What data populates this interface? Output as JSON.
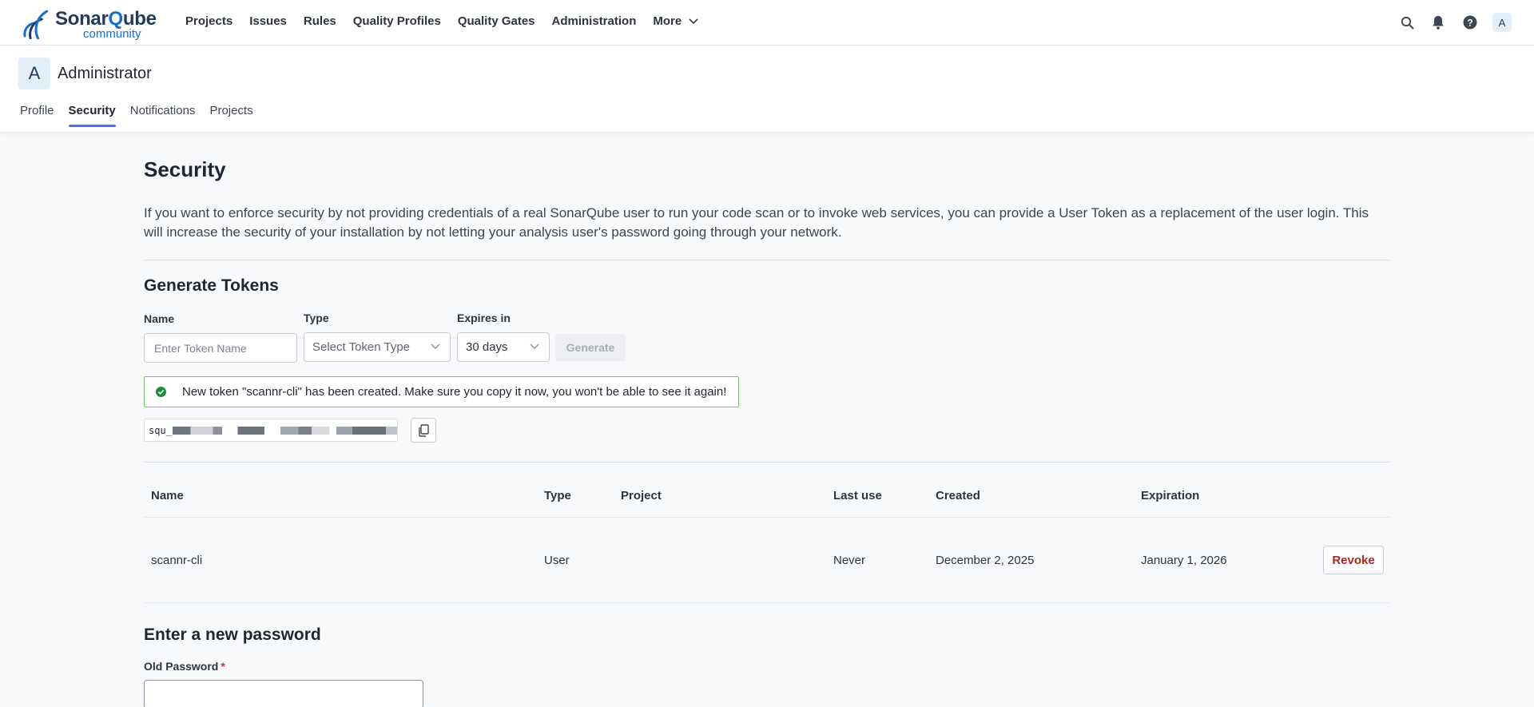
{
  "topbar": {
    "brand_prefix": "Sonar",
    "brand_q": "Q",
    "brand_suffix": "ube",
    "edition": "community",
    "nav": [
      "Projects",
      "Issues",
      "Rules",
      "Quality Profiles",
      "Quality Gates",
      "Administration",
      "More"
    ],
    "icons": [
      "search-icon",
      "bell-icon",
      "help-icon"
    ],
    "avatar_letter": "A"
  },
  "account": {
    "avatar_letter": "A",
    "name": "Administrator",
    "tabs": [
      {
        "label": "Profile",
        "active": false
      },
      {
        "label": "Security",
        "active": true
      },
      {
        "label": "Notifications",
        "active": false
      },
      {
        "label": "Projects",
        "active": false
      }
    ]
  },
  "security": {
    "title": "Security",
    "intro": "If you want to enforce security by not providing credentials of a real SonarQube user to run your code scan or to invoke web services, you can provide a User Token as a replacement of the user login. This will increase the security of your installation by not letting your analysis user's password going through your network."
  },
  "generate": {
    "title": "Generate Tokens",
    "name_label": "Name",
    "name_placeholder": "Enter Token Name",
    "type_label": "Type",
    "type_placeholder": "Select Token Type",
    "expires_label": "Expires in",
    "expires_value": "30 days",
    "generate_button": "Generate",
    "alert_message": "New token \"scannr-cli\" has been created. Make sure you copy it now, you won't be able to see it again!",
    "token_prefix": "squ_"
  },
  "tokens_table": {
    "headers": [
      "Name",
      "Type",
      "Project",
      "Last use",
      "Created",
      "Expiration"
    ],
    "rows": [
      {
        "name": "scannr-cli",
        "type": "User",
        "project": "",
        "last_use": "Never",
        "created": "December 2, 2025",
        "expiration": "January 1, 2026",
        "action": "Revoke"
      }
    ]
  },
  "password": {
    "title": "Enter a new password",
    "old_label": "Old Password",
    "required_mark": "*"
  },
  "colors": {
    "accent": "#5d6cd0",
    "brand": "#126ed3",
    "success": "#74c365",
    "danger": "#b3261e"
  }
}
